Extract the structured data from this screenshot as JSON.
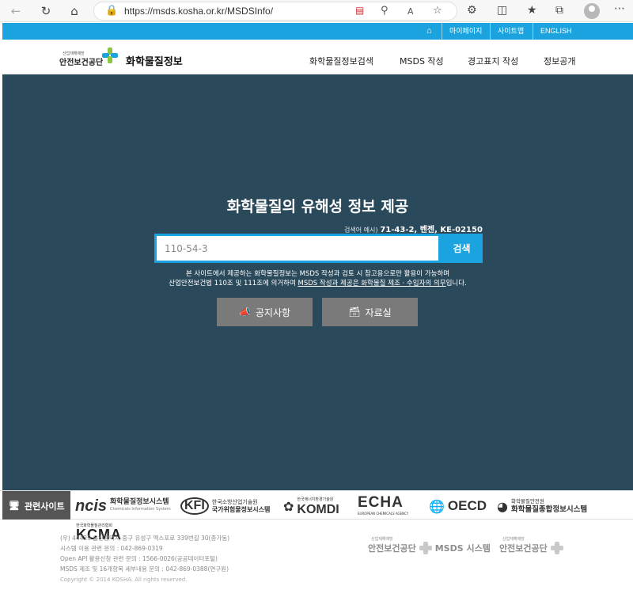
{
  "browser": {
    "url": "https://msds.kosha.or.kr/MSDSInfo/"
  },
  "util_bar": {
    "items": [
      "마이페이지",
      "사이트맵",
      "ENGLISH"
    ]
  },
  "header": {
    "org_small": "산업재해예방",
    "org_name": "안전보건공단",
    "site_title": "화학물질정보",
    "menu": [
      "화학물질정보검색",
      "MSDS 작성",
      "경고표지 작성",
      "정보공개"
    ]
  },
  "hero": {
    "title": "화학물질의 유해성 정보 제공",
    "example_label": "검색어 예시)",
    "example_values": "71-43-2, 벤젠, KE-02150",
    "search_value": "110-54-3",
    "search_button": "검색",
    "notice_line1": "본 사이트에서 제공하는 화학물질정보는 MSDS 작성과 검토 시 참고용으로만 활용이 가능하며",
    "notice_line2_pre": "산업안전보건법 110조 및 111조에 의거하여 ",
    "notice_line2_u1": "MSDS 작성과 제공은 화학물질 제조 · 수입자의 의무",
    "notice_line2_post": "입니다.",
    "btn_notice": "공지사항",
    "btn_archive": "자료실"
  },
  "related": {
    "label": "관련사이트",
    "partners": {
      "ncis_big": "ncis",
      "ncis_name": "화학물질정보시스템",
      "ncis_en": "Chemicals Information System",
      "kfi_big": "KFI",
      "kfi_line1": "한국소방산업기술원",
      "kfi_line2": "국가위험물정보시스템",
      "komdi_small": "한국에너지환경기술원",
      "komdi_big": "KOMDI",
      "echa_big": "ECHA",
      "echa_sub": "EUROPEAN CHEMICALS AGENCY",
      "oecd_big": "OECD",
      "chem_small": "화학물질안전원",
      "chem_big": "화학물질종합정보시스템"
    }
  },
  "footer": {
    "kcma_small": "한국화학물질관리협회",
    "kcma_big": "KCMA",
    "line1": "(우) 44429 울산광역시 중구 유성구 엑스포로 339번길 30(종가동)",
    "line2": "시스템 이용 관련 문의 : 042-869-0319",
    "line3": "Open API 활용신청 관련 문의 : 1566-0026(공공데이터포털)",
    "line4": "MSDS 제조 및 16개항목 세부내용 문의 : 042-869-0388(연구원)",
    "copyright": "Copyright © 2014 KOSHA. All rights reserved.",
    "logo1_small": "산업재해예방",
    "logo1_big": "안전보건공단",
    "logo1_suffix": "MSDS 시스템",
    "logo2_small": "산업재해예방",
    "logo2_big": "안전보건공단"
  },
  "colors": {
    "accent": "#1aa3de",
    "hero_bg": "#2a4a5c",
    "hero_button": "#7a7a7a"
  }
}
